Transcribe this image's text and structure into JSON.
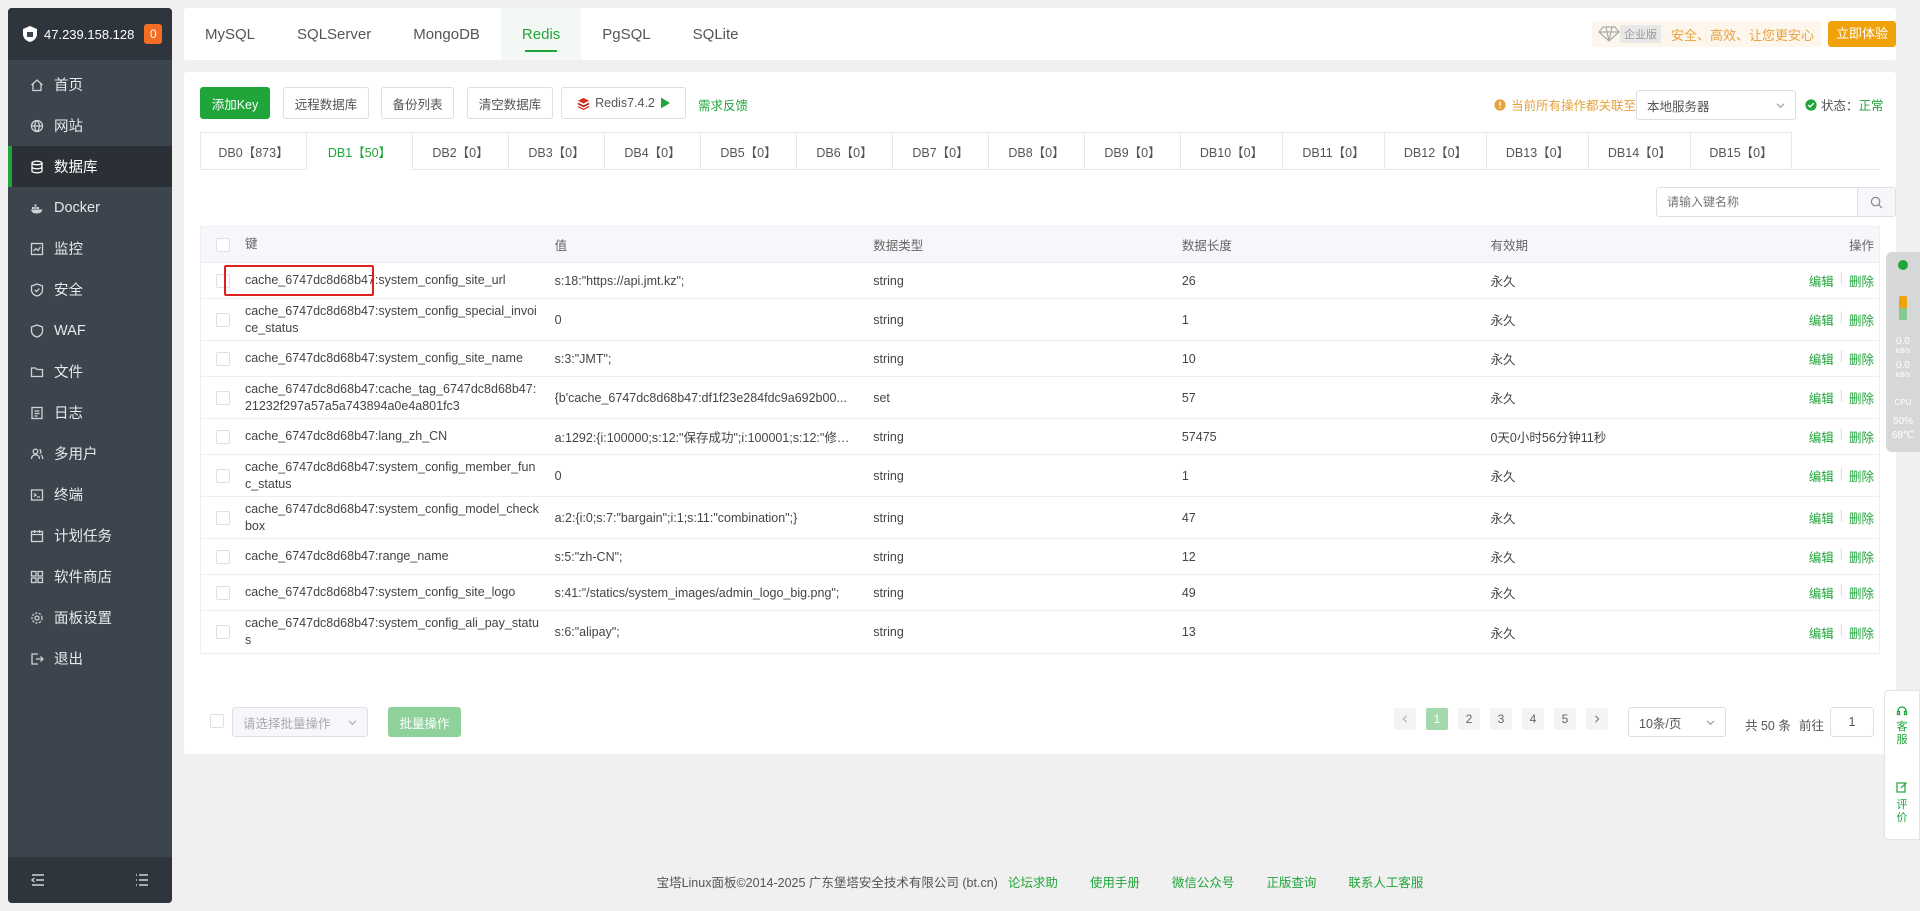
{
  "sidebar": {
    "ip": "47.239.158.128",
    "badge": "0",
    "items": [
      {
        "label": "首页",
        "icon": "home-icon"
      },
      {
        "label": "网站",
        "icon": "globe-icon"
      },
      {
        "label": "数据库",
        "icon": "database-icon"
      },
      {
        "label": "Docker",
        "icon": "docker-icon"
      },
      {
        "label": "监控",
        "icon": "monitor-icon"
      },
      {
        "label": "安全",
        "icon": "shield-icon"
      },
      {
        "label": "WAF",
        "icon": "waf-shield-icon"
      },
      {
        "label": "文件",
        "icon": "folder-icon"
      },
      {
        "label": "日志",
        "icon": "log-icon"
      },
      {
        "label": "多用户",
        "icon": "users-icon"
      },
      {
        "label": "终端",
        "icon": "terminal-icon"
      },
      {
        "label": "计划任务",
        "icon": "calendar-icon"
      },
      {
        "label": "软件商店",
        "icon": "store-icon"
      },
      {
        "label": "面板设置",
        "icon": "gear-icon"
      },
      {
        "label": "退出",
        "icon": "logout-icon"
      }
    ]
  },
  "topbar": {
    "tabs": [
      "MySQL",
      "SQLServer",
      "MongoDB",
      "Redis",
      "PgSQL",
      "SQLite"
    ],
    "edition": "企业版",
    "slogan": "安全、高效、让您更安心",
    "trial_button": "立即体验"
  },
  "toolbar": {
    "add_key": "添加Key",
    "remote_db": "远程数据库",
    "backup_list": "备份列表",
    "clear_db": "清空数据库",
    "redis_version": "Redis7.4.2",
    "feedback": "需求反馈",
    "warning": "当前所有操作都关联至",
    "server_select": "本地服务器",
    "status_label": "状态：",
    "status_value": "正常"
  },
  "db_tabs": [
    "DB0【873】",
    "DB1【50】",
    "DB2【0】",
    "DB3【0】",
    "DB4【0】",
    "DB5【0】",
    "DB6【0】",
    "DB7【0】",
    "DB8【0】",
    "DB9【0】",
    "DB10【0】",
    "DB11【0】",
    "DB12【0】",
    "DB13【0】",
    "DB14【0】",
    "DB15【0】"
  ],
  "search": {
    "placeholder": "请输入键名称"
  },
  "table": {
    "headers": {
      "key": "键",
      "value": "值",
      "type": "数据类型",
      "length": "数据长度",
      "ttl": "有效期",
      "actions": "操作"
    },
    "edit_label": "编辑",
    "delete_label": "删除",
    "rows": [
      {
        "key": "cache_6747dc8d68b47:system_config_site_url",
        "value": "s:18:\"https://api.jmt.kz\";",
        "type": "string",
        "length": "26",
        "ttl": "永久"
      },
      {
        "key": "cache_6747dc8d68b47:system_config_special_invoice_status",
        "value": "0",
        "type": "string",
        "length": "1",
        "ttl": "永久"
      },
      {
        "key": "cache_6747dc8d68b47:system_config_site_name",
        "value": "s:3:\"JMT\";",
        "type": "string",
        "length": "10",
        "ttl": "永久"
      },
      {
        "key": "cache_6747dc8d68b47:cache_tag_6747dc8d68b47:21232f297a57a5a743894a0e4a801fc3",
        "value": "{b'cache_6747dc8d68b47:df1f23e284fdc9a692b00...",
        "type": "set",
        "length": "57",
        "ttl": "永久"
      },
      {
        "key": "cache_6747dc8d68b47:lang_zh_CN",
        "value": "a:1292:{i:100000;s:12:\"保存成功\";i:100001;s:12:\"修改...",
        "type": "string",
        "length": "57475",
        "ttl": "0天0小时56分钟11秒"
      },
      {
        "key": "cache_6747dc8d68b47:system_config_member_func_status",
        "value": "0",
        "type": "string",
        "length": "1",
        "ttl": "永久"
      },
      {
        "key": "cache_6747dc8d68b47:system_config_model_checkbox",
        "value": "a:2:{i:0;s:7:\"bargain\";i:1;s:11:\"combination\";}",
        "type": "string",
        "length": "47",
        "ttl": "永久"
      },
      {
        "key": "cache_6747dc8d68b47:range_name",
        "value": "s:5:\"zh-CN\";",
        "type": "string",
        "length": "12",
        "ttl": "永久"
      },
      {
        "key": "cache_6747dc8d68b47:system_config_site_logo",
        "value": "s:41:\"/statics/system_images/admin_logo_big.png\";",
        "type": "string",
        "length": "49",
        "ttl": "永久"
      },
      {
        "key": "cache_6747dc8d68b47:system_config_ali_pay_status",
        "value": "s:6:\"alipay\";",
        "type": "string",
        "length": "13",
        "ttl": "永久"
      }
    ]
  },
  "bulk": {
    "placeholder": "请选择批量操作",
    "button": "批量操作"
  },
  "pagination": {
    "pages": [
      "1",
      "2",
      "3",
      "4",
      "5"
    ],
    "page_size": "10条/页",
    "total": "共 50 条",
    "goto_label": "前往",
    "goto_value": "1"
  },
  "footer": {
    "copyright": "宝塔Linux面板©2014-2025 广东堡塔安全技术有限公司 (bt.cn)",
    "links": [
      "论坛求助",
      "使用手册",
      "微信公众号",
      "正版查询",
      "联系人工客服"
    ]
  },
  "right_widget": {
    "net1": "0.0",
    "net1_unit": "KB/s",
    "net2": "0.0",
    "net2_unit": "KB/s",
    "cpu_label": "CPU",
    "cpu_value": "50%",
    "temp": "68℃"
  },
  "right_float": {
    "service": "客服",
    "review": "评价"
  },
  "colors": {
    "accent": "#20a53a",
    "warning": "#e6a23c",
    "sidebar": "#3c444d",
    "highlight": "#e02020"
  }
}
